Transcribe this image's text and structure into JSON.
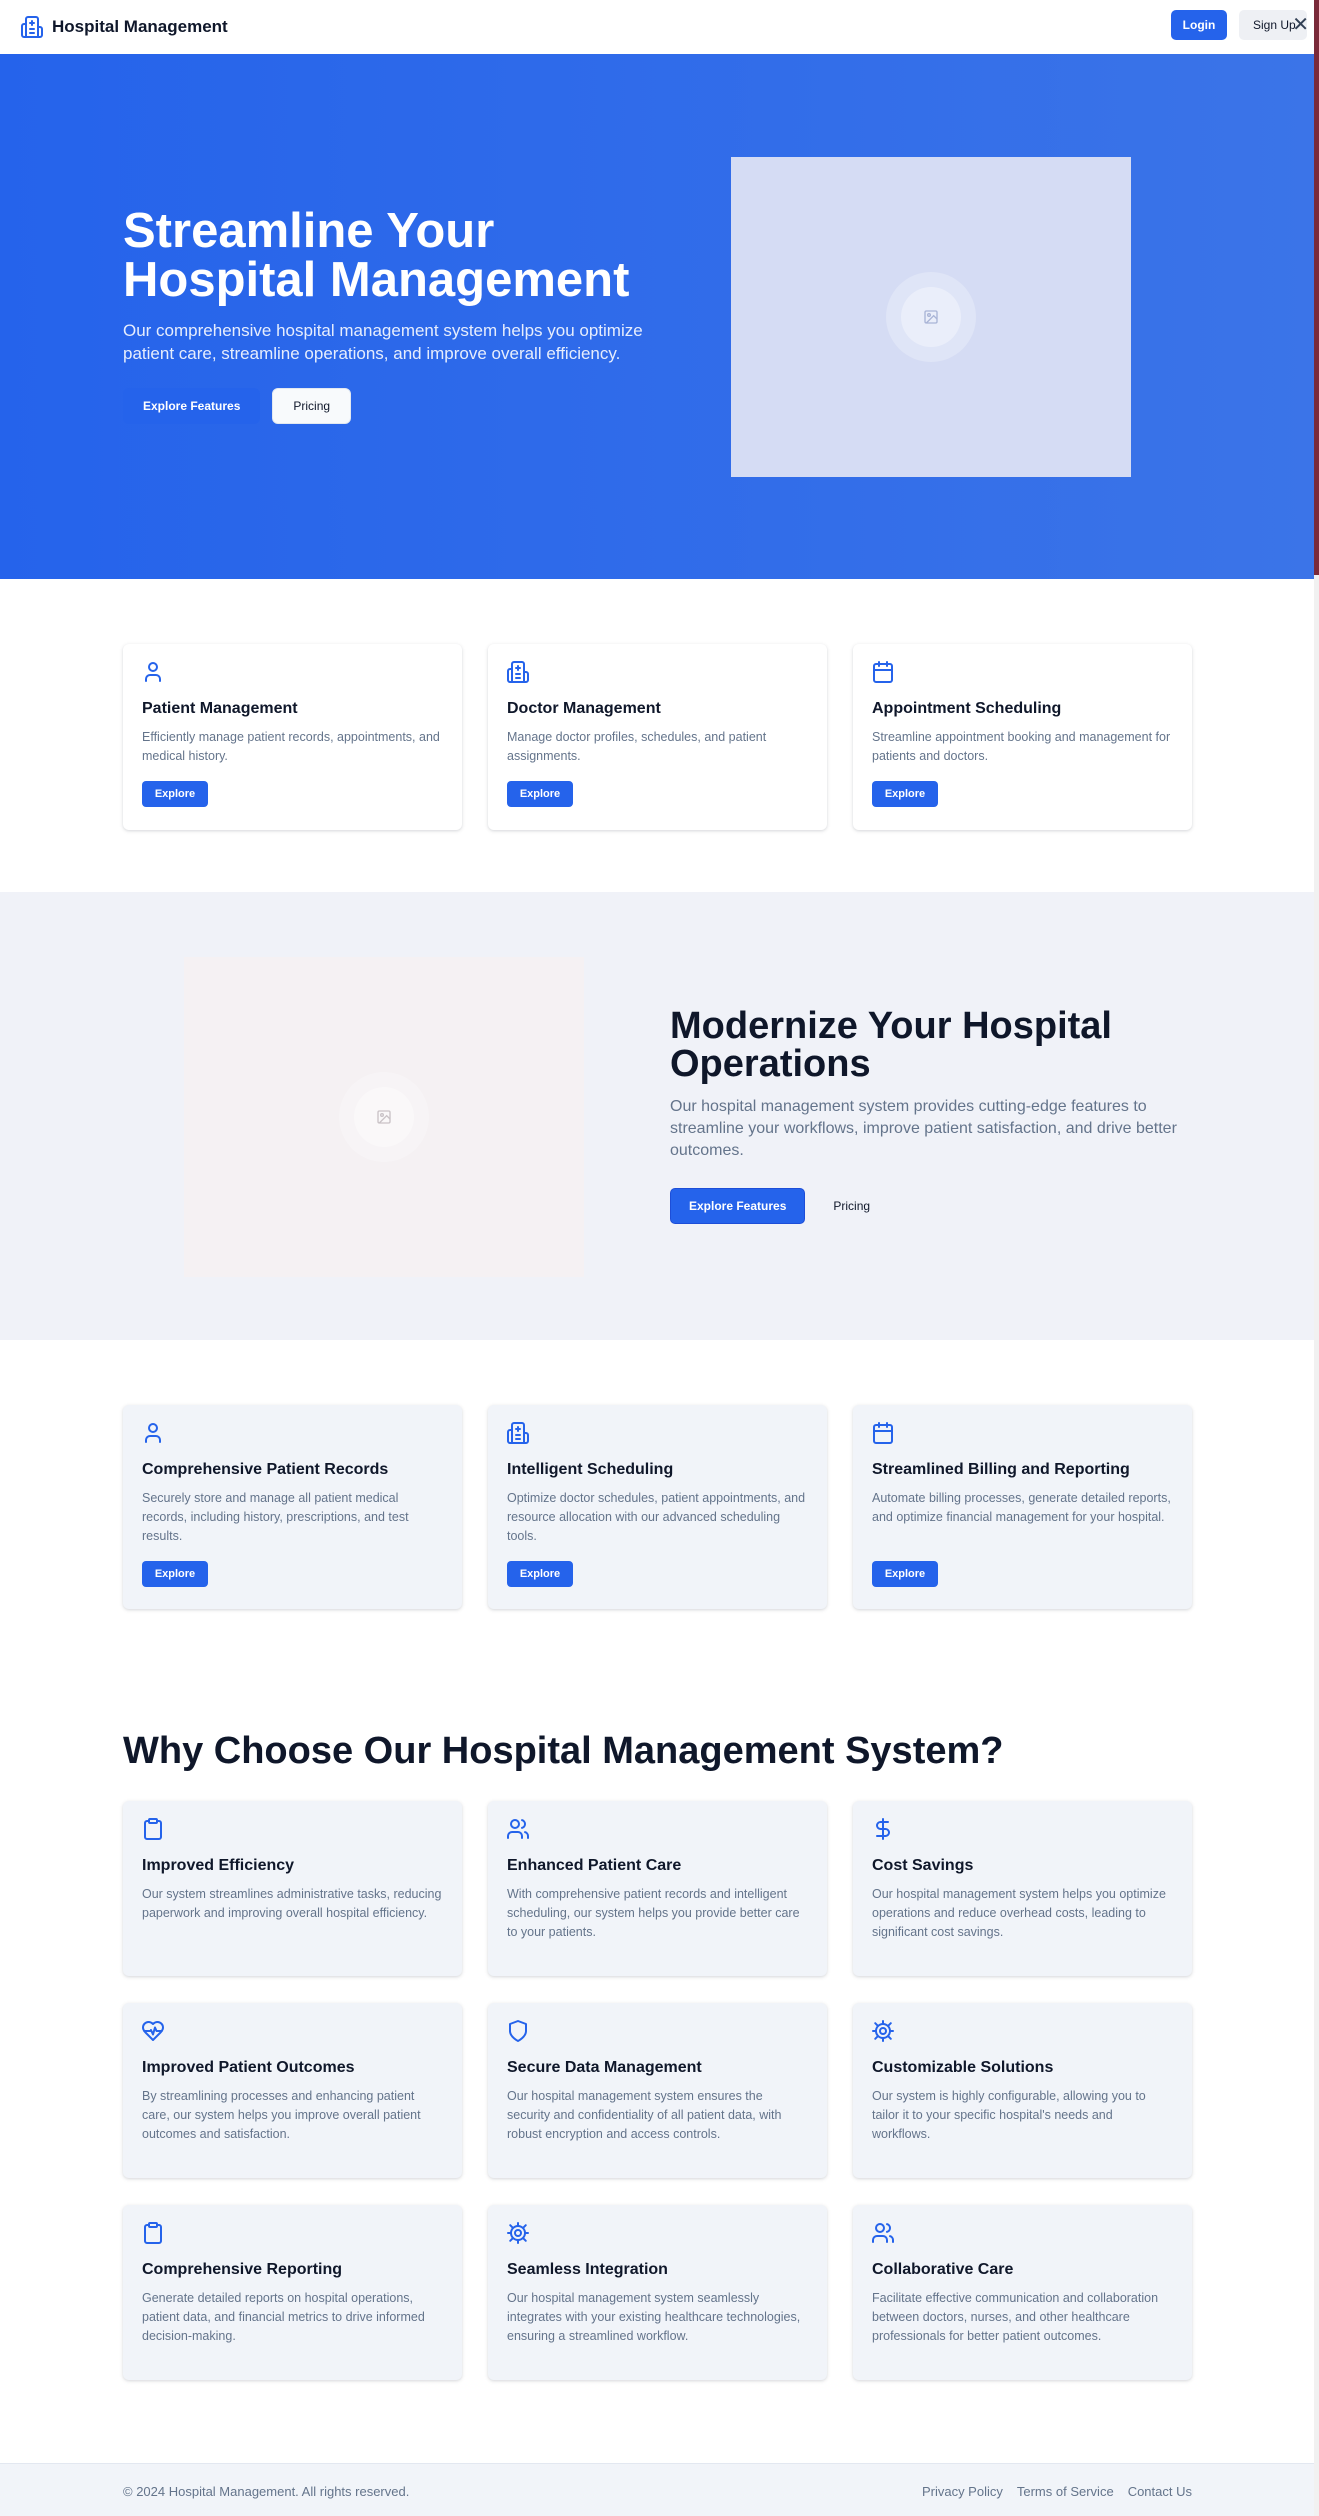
{
  "header": {
    "title": "Hospital Management",
    "login_label": "Login",
    "signup_label": "Sign Up",
    "close_symbol": "✕"
  },
  "hero": {
    "heading": "Streamline Your Hospital Management",
    "description": "Our comprehensive hospital management system helps you optimize patient care, streamline operations, and improve overall efficiency.",
    "primary_label": "Explore Features",
    "secondary_label": "Pricing"
  },
  "features": [
    {
      "icon": "user-icon",
      "title": "Patient Management",
      "desc": "Efficiently manage patient records, appointments, and medical history.",
      "button": "Explore"
    },
    {
      "icon": "hospital-icon",
      "title": "Doctor Management",
      "desc": "Manage doctor profiles, schedules, and patient assignments.",
      "button": "Explore"
    },
    {
      "icon": "calendar-icon",
      "title": "Appointment Scheduling",
      "desc": "Streamline appointment booking and management for patients and doctors.",
      "button": "Explore"
    }
  ],
  "modernize": {
    "heading": "Modernize Your Hospital Operations",
    "description": "Our hospital management system provides cutting-edge features to streamline your workflows, improve patient satisfaction, and drive better outcomes.",
    "primary_label": "Explore Features",
    "secondary_label": "Pricing"
  },
  "features2": [
    {
      "icon": "user-icon",
      "title": "Comprehensive Patient Records",
      "desc": "Securely store and manage all patient medical records, including history, prescriptions, and test results.",
      "button": "Explore"
    },
    {
      "icon": "hospital-icon",
      "title": "Intelligent Scheduling",
      "desc": "Optimize doctor schedules, patient appointments, and resource allocation with our advanced scheduling tools.",
      "button": "Explore"
    },
    {
      "icon": "calendar-icon",
      "title": "Streamlined Billing and Reporting",
      "desc": "Automate billing processes, generate detailed reports, and optimize financial management for your hospital.",
      "button": "Explore"
    }
  ],
  "why": {
    "heading": "Why Choose Our Hospital Management System?",
    "items": [
      {
        "icon": "clipboard-icon",
        "title": "Improved Efficiency",
        "desc": "Our system streamlines administrative tasks, reducing paperwork and improving overall hospital efficiency."
      },
      {
        "icon": "users-icon",
        "title": "Enhanced Patient Care",
        "desc": "With comprehensive patient records and intelligent scheduling, our system helps you provide better care to your patients."
      },
      {
        "icon": "dollar-icon",
        "title": "Cost Savings",
        "desc": "Our hospital management system helps you optimize operations and reduce overhead costs, leading to significant cost savings."
      },
      {
        "icon": "heart-pulse-icon",
        "title": "Improved Patient Outcomes",
        "desc": "By streamlining processes and enhancing patient care, our system helps you improve overall patient outcomes and satisfaction."
      },
      {
        "icon": "shield-icon",
        "title": "Secure Data Management",
        "desc": "Our hospital management system ensures the security and confidentiality of all patient data, with robust encryption and access controls."
      },
      {
        "icon": "gear-icon",
        "title": "Customizable Solutions",
        "desc": "Our system is highly configurable, allowing you to tailor it to your specific hospital's needs and workflows."
      },
      {
        "icon": "clipboard-icon",
        "title": "Comprehensive Reporting",
        "desc": "Generate detailed reports on hospital operations, patient data, and financial metrics to drive informed decision-making."
      },
      {
        "icon": "gear-icon",
        "title": "Seamless Integration",
        "desc": "Our hospital management system seamlessly integrates with your existing healthcare technologies, ensuring a streamlined workflow."
      },
      {
        "icon": "users-icon",
        "title": "Collaborative Care",
        "desc": "Facilitate effective communication and collaboration between doctors, nurses, and other healthcare professionals for better patient outcomes."
      }
    ]
  },
  "footer": {
    "copyright": "© 2024 Hospital Management. All rights reserved.",
    "links": [
      "Privacy Policy",
      "Terms of Service",
      "Contact Us"
    ]
  },
  "colors": {
    "primary": "#2563eb",
    "text": "#0f172a",
    "muted": "#64748b",
    "section_bg": "#f0f2f8"
  }
}
